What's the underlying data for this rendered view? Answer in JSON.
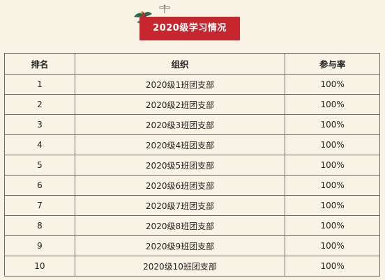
{
  "banner": {
    "title": "2020级学习情况"
  },
  "table": {
    "headers": [
      "排名",
      "组织",
      "参与率"
    ],
    "rows": [
      {
        "rank": "1",
        "org": "2020级1班团支部",
        "rate": "100%"
      },
      {
        "rank": "2",
        "org": "2020级2班团支部",
        "rate": "100%"
      },
      {
        "rank": "3",
        "org": "2020级3班团支部",
        "rate": "100%"
      },
      {
        "rank": "4",
        "org": "2020级4班团支部",
        "rate": "100%"
      },
      {
        "rank": "5",
        "org": "2020级5班团支部",
        "rate": "100%"
      },
      {
        "rank": "6",
        "org": "2020级6班团支部",
        "rate": "100%"
      },
      {
        "rank": "7",
        "org": "2020级7班团支部",
        "rate": "100%"
      },
      {
        "rank": "8",
        "org": "2020级8班团支部",
        "rate": "100%"
      },
      {
        "rank": "9",
        "org": "2020级9班团支部",
        "rate": "100%"
      },
      {
        "rank": "10",
        "org": "2020级10班团支部",
        "rate": "100%"
      }
    ]
  },
  "colors": {
    "background": "#f8f3e4",
    "banner": "#c8262e",
    "border": "#6b6b6b"
  }
}
